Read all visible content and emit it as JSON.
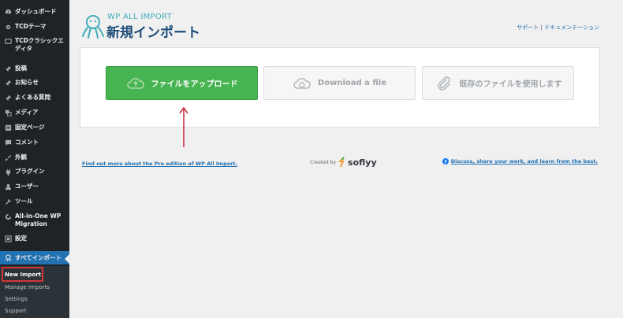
{
  "sidebar": {
    "items": [
      {
        "label": "ダッシュボード",
        "icon": "dashboard-icon"
      },
      {
        "label": "TCDテーマ",
        "icon": "gear-icon"
      },
      {
        "label": "TCDクラシックエディタ",
        "icon": "editor-icon"
      },
      {
        "label": "投稿",
        "icon": "pin-icon"
      },
      {
        "label": "お知らせ",
        "icon": "pin-icon"
      },
      {
        "label": "よくある質問",
        "icon": "pin-icon"
      },
      {
        "label": "メディア",
        "icon": "media-icon"
      },
      {
        "label": "固定ページ",
        "icon": "page-icon"
      },
      {
        "label": "コメント",
        "icon": "comment-icon"
      },
      {
        "label": "外観",
        "icon": "brush-icon"
      },
      {
        "label": "プラグイン",
        "icon": "plugin-icon"
      },
      {
        "label": "ユーザー",
        "icon": "user-icon"
      },
      {
        "label": "ツール",
        "icon": "wrench-icon"
      },
      {
        "label": "All-in-One WP Migration",
        "icon": "migration-icon"
      },
      {
        "label": "設定",
        "icon": "settings-icon"
      }
    ],
    "active": {
      "label": "すべてインポート",
      "icon": "octopus-icon"
    },
    "submenu": [
      "New Import",
      "Manage Imports",
      "Settings",
      "Support"
    ]
  },
  "header": {
    "brand_small": "WP ALL IMPORT",
    "title": "新規インポート",
    "link_support": "サポート",
    "separator": "|",
    "link_docs": "ドキュメンテーション"
  },
  "options": {
    "upload": "ファイルをアップロード",
    "download": "Download a file",
    "existing": "既存のファイルを使用します"
  },
  "footer": {
    "pro_link": "Find out more about the Pro edition of WP All Import.",
    "created_by": "Created by",
    "company": "soflyy",
    "community": "Discuss, share your work, and learn from the best."
  },
  "colors": {
    "sidebar_bg": "#1d2327",
    "active_bg": "#2271b1",
    "upload_green": "#46b450",
    "link_blue": "#2271b1",
    "annotation_red": "#d63638"
  }
}
